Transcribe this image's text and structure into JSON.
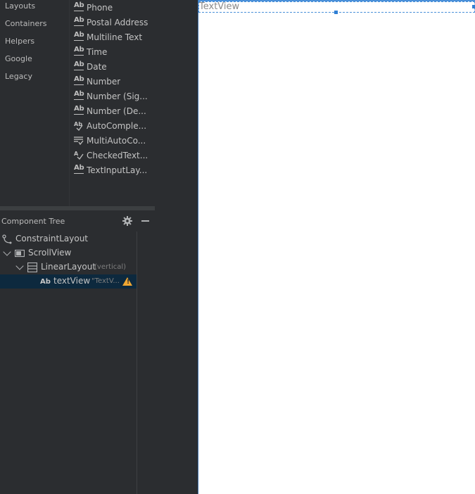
{
  "palette": {
    "categories": [
      "Layouts",
      "Containers",
      "Helpers",
      "Google",
      "Legacy"
    ],
    "items": [
      {
        "label": "Phone",
        "icon": "text-ab-icon"
      },
      {
        "label": "Postal Address",
        "icon": "text-ab-icon"
      },
      {
        "label": "Multiline Text",
        "icon": "text-ab-icon"
      },
      {
        "label": "Time",
        "icon": "text-ab-icon"
      },
      {
        "label": "Date",
        "icon": "text-ab-icon"
      },
      {
        "label": "Number",
        "icon": "text-ab-icon"
      },
      {
        "label": "Number (Sig...",
        "icon": "text-ab-icon"
      },
      {
        "label": "Number (De...",
        "icon": "text-ab-icon"
      },
      {
        "label": "AutoComple...",
        "icon": "autocomplete-icon"
      },
      {
        "label": "MultiAutoCo...",
        "icon": "multi-autocomplete-icon"
      },
      {
        "label": "CheckedText...",
        "icon": "checked-text-icon"
      },
      {
        "label": "TextInputLay...",
        "icon": "text-ab-icon"
      }
    ]
  },
  "component_tree": {
    "title": "Component Tree",
    "rows": [
      {
        "label": "ConstraintLayout",
        "sub": "",
        "icon": "constraint-layout-icon"
      },
      {
        "label": "ScrollView",
        "sub": "",
        "icon": "scrollview-icon"
      },
      {
        "label": "LinearLayout",
        "sub": "(vertical)",
        "icon": "linear-layout-icon"
      },
      {
        "label": "textView",
        "sub": "\"TextV...",
        "icon": "text-ab-icon"
      }
    ]
  },
  "canvas": {
    "textview_text": "TextView"
  },
  "colors": {
    "panel_bg": "#2b2d30",
    "selected_row": "#0d293e",
    "selection_blue": "#4a90d9",
    "warning": "#f0a732"
  }
}
